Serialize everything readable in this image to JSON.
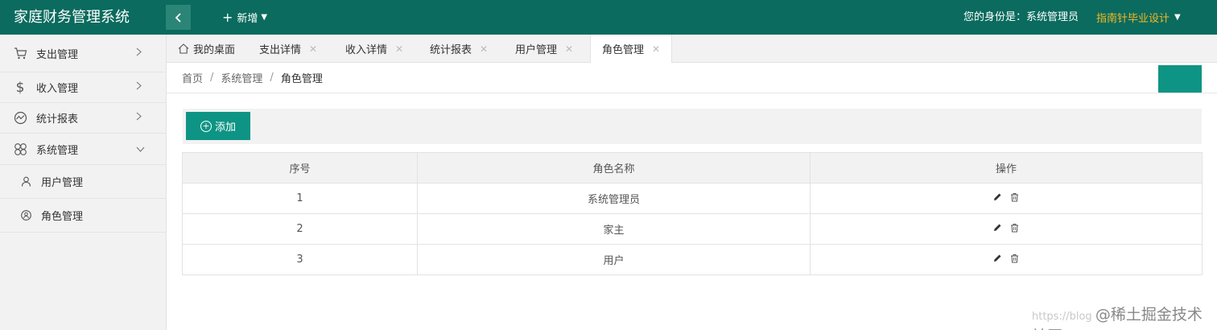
{
  "header": {
    "logo": "家庭财务管理系统",
    "add_new": "新增",
    "identity": "您的身份是：系统管理员",
    "user_menu": "指南针毕业设计"
  },
  "sidebar": {
    "items": [
      {
        "label": "支出管理",
        "icon": "cart-icon"
      },
      {
        "label": "收入管理",
        "icon": "dollar-icon"
      },
      {
        "label": "统计报表",
        "icon": "chart-icon"
      },
      {
        "label": "系统管理",
        "icon": "clover-icon"
      }
    ],
    "subitems": [
      {
        "label": "用户管理",
        "icon": "user-icon"
      },
      {
        "label": "角色管理",
        "icon": "role-icon"
      }
    ]
  },
  "tabs": [
    {
      "label": "我的桌面"
    },
    {
      "label": "支出详情"
    },
    {
      "label": "收入详情"
    },
    {
      "label": "统计报表"
    },
    {
      "label": "用户管理"
    },
    {
      "label": "角色管理"
    }
  ],
  "breadcrumb": {
    "home": "首页",
    "sep": "/",
    "parent": "系统管理",
    "current": "角色管理"
  },
  "toolbar": {
    "add_label": "添加"
  },
  "table": {
    "headers": [
      "序号",
      "角色名称",
      "操作"
    ],
    "rows": [
      {
        "index": "1",
        "name": "系统管理员"
      },
      {
        "index": "2",
        "name": "家主"
      },
      {
        "index": "3",
        "name": "用户"
      }
    ]
  },
  "watermark": {
    "url": "https://blog",
    "brand": "@稀土掘金技术社区"
  },
  "colors": {
    "header_bg": "#0a6b5e",
    "primary": "#0e9484",
    "user_menu": "#f7b824"
  }
}
